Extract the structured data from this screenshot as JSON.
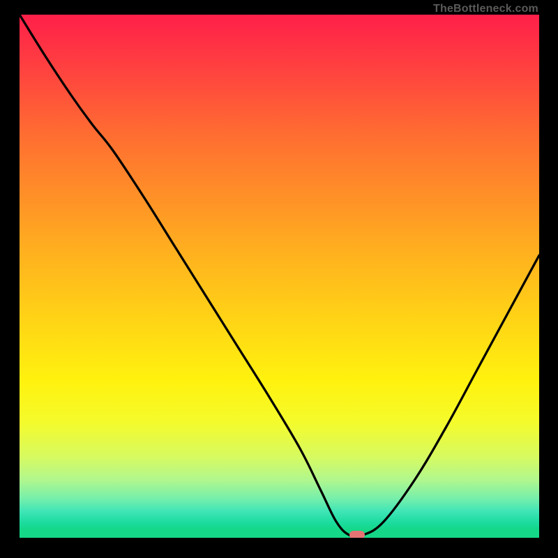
{
  "attribution": "TheBottleneck.com",
  "chart_data": {
    "type": "line",
    "title": "",
    "xlabel": "",
    "ylabel": "",
    "xlim": [
      0,
      100
    ],
    "ylim": [
      0,
      100
    ],
    "series": [
      {
        "name": "bottleneck-curve",
        "x": [
          0,
          5,
          10,
          14,
          18,
          24,
          30,
          36,
          42,
          48,
          54,
          58,
          61,
          63.5,
          66,
          70,
          76,
          82,
          88,
          94,
          100
        ],
        "y": [
          100,
          92,
          84.5,
          79,
          74,
          65,
          55.5,
          46,
          36.5,
          27,
          17,
          9,
          3,
          0.5,
          0.5,
          3,
          11,
          21,
          32,
          43,
          54
        ]
      }
    ],
    "marker": {
      "x": 65,
      "y": 0.5
    },
    "gradient_stops": [
      {
        "pos": 0,
        "color": "#ff1f49"
      },
      {
        "pos": 0.7,
        "color": "#fff20e"
      },
      {
        "pos": 1.0,
        "color": "#14d787"
      }
    ]
  }
}
